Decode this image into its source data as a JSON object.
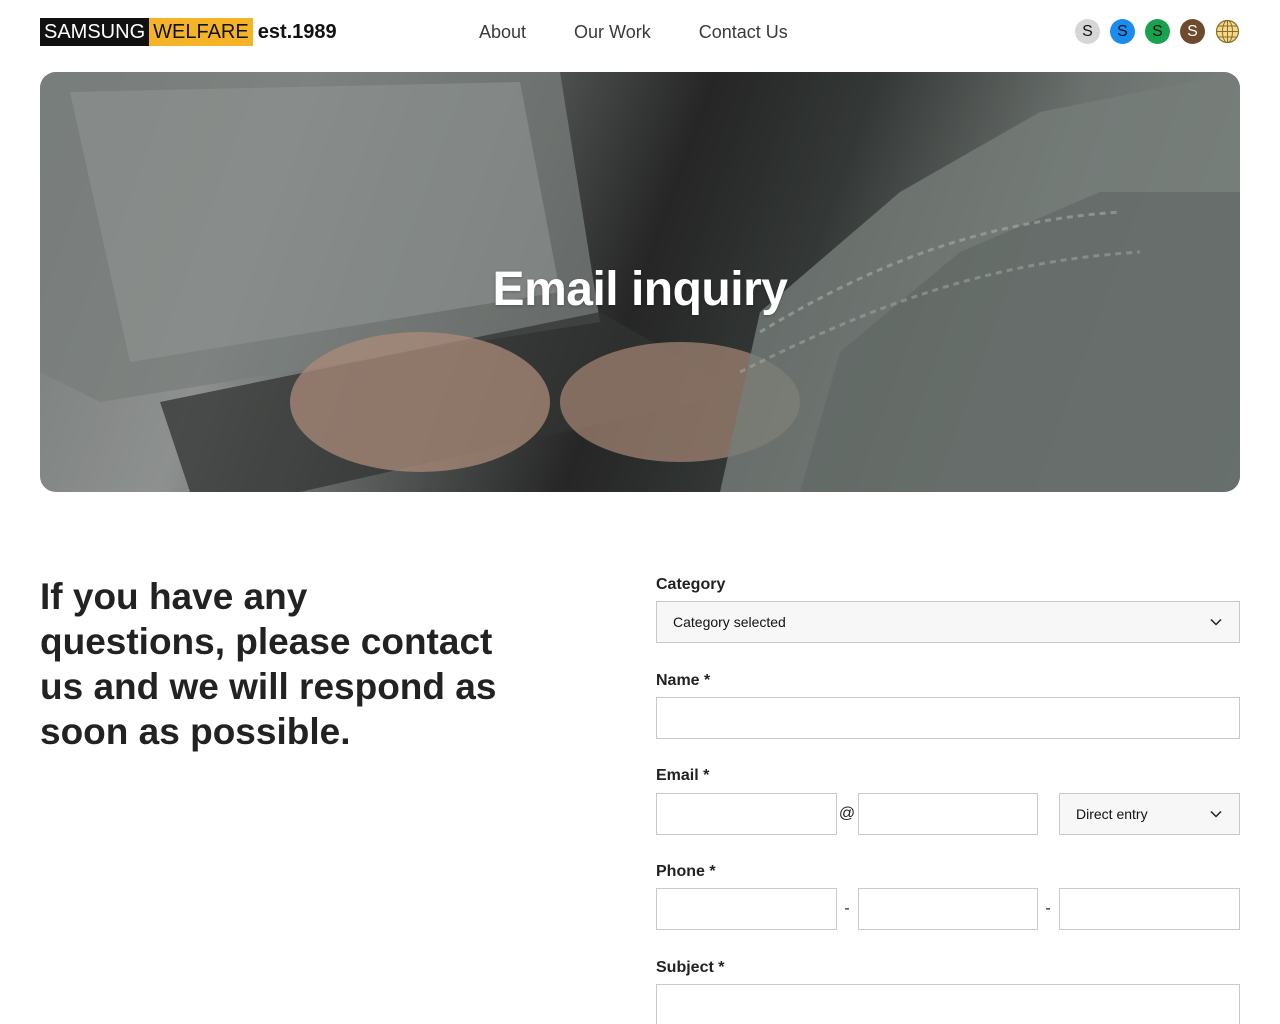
{
  "header": {
    "logo_part1": "SAMSUNG",
    "logo_part2": "WELFARE",
    "logo_part3": "est.1989",
    "nav": [
      "About",
      "Our Work",
      "Contact Us"
    ],
    "socials": [
      "S",
      "S",
      "S",
      "S"
    ],
    "colors": {
      "logo_dark": "#111111",
      "logo_accent": "#f5b427",
      "social_gray": "#d6d6d6",
      "social_blue": "#1a8cf0",
      "social_green": "#18a24f",
      "social_brown": "#6f4b2e"
    }
  },
  "hero": {
    "title": "Email inquiry"
  },
  "intro": {
    "text": "If you have any questions, please contact us and we will respond as soon as possible."
  },
  "form": {
    "category_label": "Category",
    "category_value": "Category selected",
    "name_label": "Name *",
    "name_value": "",
    "email_label": "Email *",
    "email_at": "@",
    "email_domain_select": "Direct entry",
    "phone_label": "Phone *",
    "phone_sep": "-",
    "subject_label": "Subject *"
  }
}
